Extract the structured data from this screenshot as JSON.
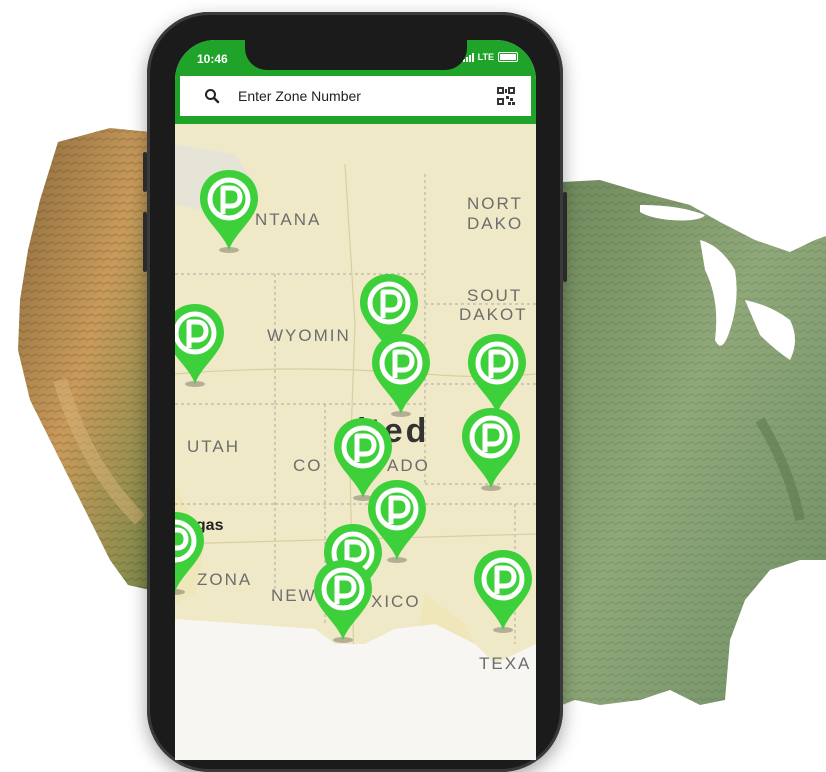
{
  "status_bar": {
    "time": "10:46",
    "network": "LTE"
  },
  "search": {
    "placeholder": "Enter Zone Number"
  },
  "map": {
    "state_labels": [
      "NTANA",
      "NORT",
      "DAKO",
      "SOUT",
      "DAKOT",
      "WYOMIN",
      "UTAH",
      "CO",
      "ADO",
      "ZONA",
      "NEW",
      "XICO",
      "TEXA"
    ],
    "country_label": "ited",
    "city_labels": [
      "egas"
    ],
    "pin_icon": "parking-pin-icon",
    "pin_count": 13
  },
  "colors": {
    "brand_green": "#1fa329",
    "pin_green": "#3dd03b"
  }
}
